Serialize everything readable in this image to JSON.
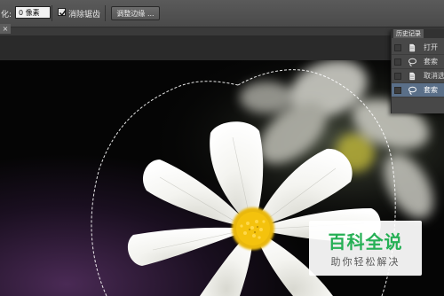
{
  "options_bar": {
    "feather_label": "化:",
    "feather_value": "0 像素",
    "antialias_label": "消除锯齿",
    "antialias_checked": true,
    "refine_edge_button": "调整边缘 ..."
  },
  "document_tab": {
    "close_label": "×"
  },
  "history_panel": {
    "title": "历史记录",
    "items": [
      {
        "label": "打开",
        "icon": "document-icon",
        "active": false
      },
      {
        "label": "套索",
        "icon": "lasso-icon",
        "active": false
      },
      {
        "label": "取消选",
        "icon": "document-icon",
        "active": false
      },
      {
        "label": "套索",
        "icon": "lasso-icon",
        "active": true
      }
    ]
  },
  "watermark": {
    "title": "百科全说",
    "subtitle": "助你轻松解决"
  },
  "colors": {
    "selection_row": "#5a6f88",
    "watermark_green": "#26b055",
    "flower_center": "#f4c20d"
  }
}
